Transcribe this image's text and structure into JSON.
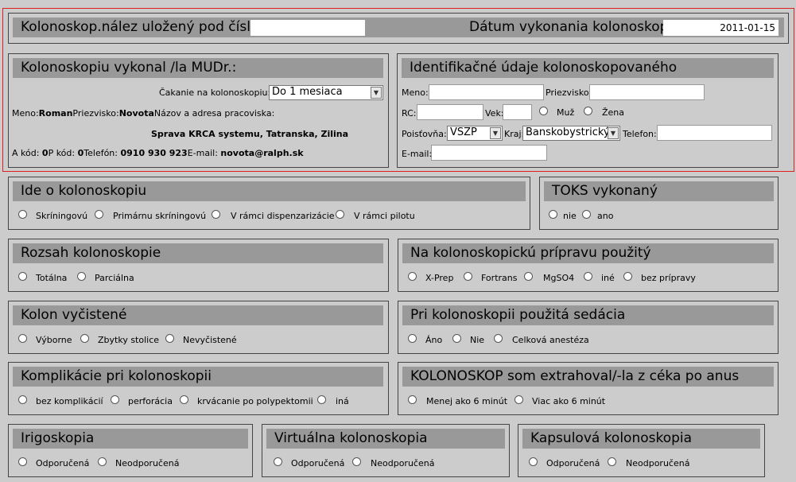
{
  "header": {
    "report_label": "Kolonoskop.nález uložený pod číslom:",
    "report_value": "",
    "date_label": "Dátum vykonania kolonoskopie",
    "date_value": "2011-01-15"
  },
  "doctor": {
    "title": "Kolonoskopiu vykonal /la MUDr.:",
    "wait_label": "Čakanie na kolonoskopiu:",
    "wait_value": "Do 1 mesiaca",
    "meno_label": "Meno:",
    "meno": "Roman",
    "priezvisko_label": "Priezvisko:",
    "priezvisko": "Novota",
    "address_label": "Názov a adresa pracoviska:",
    "address": "Sprava KRCA systemu, Tatranska, Zilina",
    "a_kod_label": "A kód:",
    "a_kod": "0",
    "p_kod_label": "P kód:",
    "p_kod": "0",
    "telefon_label": "Telefón:",
    "telefon": "0910 930 923",
    "email_label": "E-mail:",
    "email": "novota@ralph.sk"
  },
  "patient": {
    "title": "Identifikačné údaje kolonoskopovaného",
    "meno_label": "Meno:",
    "priezvisko_label": "Priezvisko:",
    "rc_label": "RC:",
    "vek_label": "Vek:",
    "muz_label": "Muž",
    "zena_label": "Žena",
    "poistovna_label": "Poisťovňa:",
    "poistovna_value": "VSZP",
    "kraj_label": "Kraj:",
    "kraj_value": "Banskobystrický",
    "telefon_label": "Telefon:",
    "email_label": "E-mail:"
  },
  "sections": {
    "ide": {
      "title": "Ide o kolonoskopiu",
      "options": [
        "Skríningovú",
        "Primárnu skríningovú",
        "V rámci dispenzarizácie",
        "V rámci pilotu"
      ]
    },
    "toks": {
      "title": "TOKS vykonaný",
      "options": [
        "nie",
        "ano"
      ]
    },
    "rozsah": {
      "title": "Rozsah kolonoskopie",
      "options": [
        "Totálna",
        "Parciálna"
      ]
    },
    "priprava": {
      "title": "Na kolonoskopickú prípravu použitý",
      "options": [
        "X-Prep",
        "Fortrans",
        "MgSO4",
        "iné",
        "bez prípravy"
      ]
    },
    "kolon": {
      "title": "Kolon vyčistené",
      "options": [
        "Výborne",
        "Zbytky stolice",
        "Nevyčistené"
      ]
    },
    "sedacia": {
      "title": "Pri kolonoskopii použitá sedácia",
      "options": [
        "Áno",
        "Nie",
        "Celková anestéza"
      ]
    },
    "komplikacie": {
      "title": "Komplikácie pri kolonoskopii",
      "options": [
        "bez komplikácií",
        "perforácia",
        "krvácanie po polypektomii",
        "iná"
      ]
    },
    "extrahoval": {
      "title": "KOLONOSKOP som extrahoval/-la z céka po anus",
      "options": [
        "Menej ako 6 minút",
        "Viac ako 6 minút"
      ]
    },
    "irigoskopia": {
      "title": "Irigoskopia",
      "options": [
        "Odporučená",
        "Neodporučená"
      ]
    },
    "virtualna": {
      "title": "Virtuálna kolonoskopia",
      "options": [
        "Odporučená",
        "Neodporučená"
      ]
    },
    "kapsulova": {
      "title": "Kapsulová kolonoskopia",
      "options": [
        "Odporučená",
        "Neodporučená"
      ]
    }
  }
}
